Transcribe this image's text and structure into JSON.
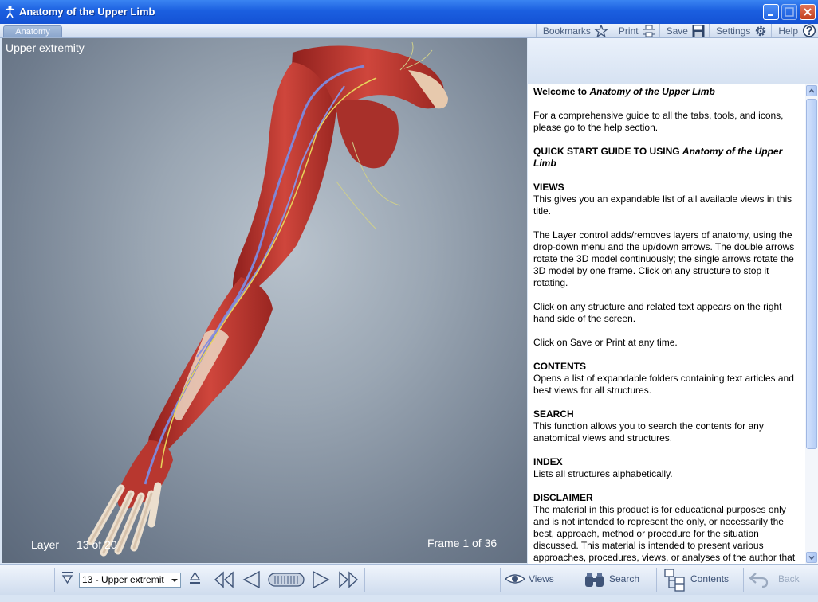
{
  "window": {
    "title": "Anatomy of the Upper Limb",
    "icon": "stick-figure-icon"
  },
  "tabs": [
    {
      "label": "Anatomy",
      "active": true
    }
  ],
  "toolbar": {
    "bookmarks": "Bookmarks",
    "print": "Print",
    "save": "Save",
    "settings": "Settings",
    "help": "Help"
  },
  "viewer": {
    "caption": "Upper extremity",
    "layer_label": "Layer",
    "layer_count": "13 of 20",
    "frame_label": "Frame 1 of 36"
  },
  "article": {
    "welcome_prefix": "Welcome to ",
    "welcome_title": "Anatomy of the Upper Limb",
    "intro": "For a comprehensive guide to all the tabs, tools, and icons, please go to the help section.",
    "quickstart_prefix": "QUICK START GUIDE TO USING ",
    "quickstart_title": "Anatomy of the Upper Limb",
    "views_heading": "VIEWS",
    "views_text": "This gives you an expandable list of all available views in this title.",
    "layer_text": "The Layer control adds/removes layers of anatomy, using the drop-down menu and the up/down arrows. The double arrows rotate the 3D model continuously; the single arrows rotate the 3D model by one frame. Click on any structure to stop it rotating.",
    "click_text": "Click on any structure and related text appears on the right hand side of the screen.",
    "save_text": "Click on Save or Print at any time.",
    "contents_heading": "CONTENTS",
    "contents_text": "Opens a list of expandable folders containing text articles and best views for all structures.",
    "search_heading": "SEARCH",
    "search_text": "This function allows you to search the contents for any anatomical views and structures.",
    "index_heading": "INDEX",
    "index_text": "Lists all structures alphabetically.",
    "disclaimer_heading": "DISCLAIMER",
    "disclaimer_text": "The material in this product is for educational purposes only and is not intended to represent the only, or necessarily the best, approach, method or procedure for the situation discussed. This material is intended to present various approaches, procedures, views, or analyses of the author that may be helpful to others who face similar situations."
  },
  "bottom": {
    "layer_select_value": "13 - Upper extremit",
    "views": "Views",
    "search": "Search",
    "contents": "Contents",
    "back": "Back"
  },
  "colors": {
    "titlebar": "#1b5fe0",
    "muscle": "#c23a33",
    "vein": "#7f86d6",
    "nerve": "#e6d35a"
  }
}
